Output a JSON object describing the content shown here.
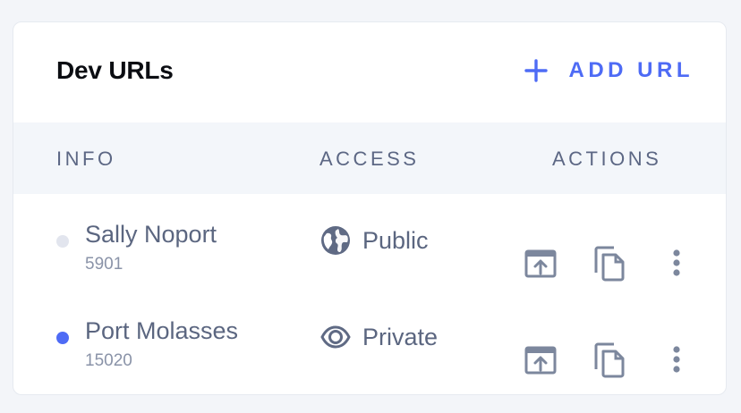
{
  "card": {
    "title": "Dev URLs",
    "add_label": "ADD URL"
  },
  "table": {
    "headers": {
      "info": "INFO",
      "access": "ACCESS",
      "actions": "ACTIONS"
    },
    "rows": [
      {
        "name": "Sally Noport",
        "port": "5901",
        "access": "Public",
        "access_icon": "globe-icon",
        "status_color": "#e2e5ee"
      },
      {
        "name": "Port Molasses",
        "port": "15020",
        "access": "Private",
        "access_icon": "eye-icon",
        "status_color": "#4e6bf5"
      }
    ]
  },
  "colors": {
    "accent": "#4e6bf5",
    "icon": "#7c879d"
  }
}
